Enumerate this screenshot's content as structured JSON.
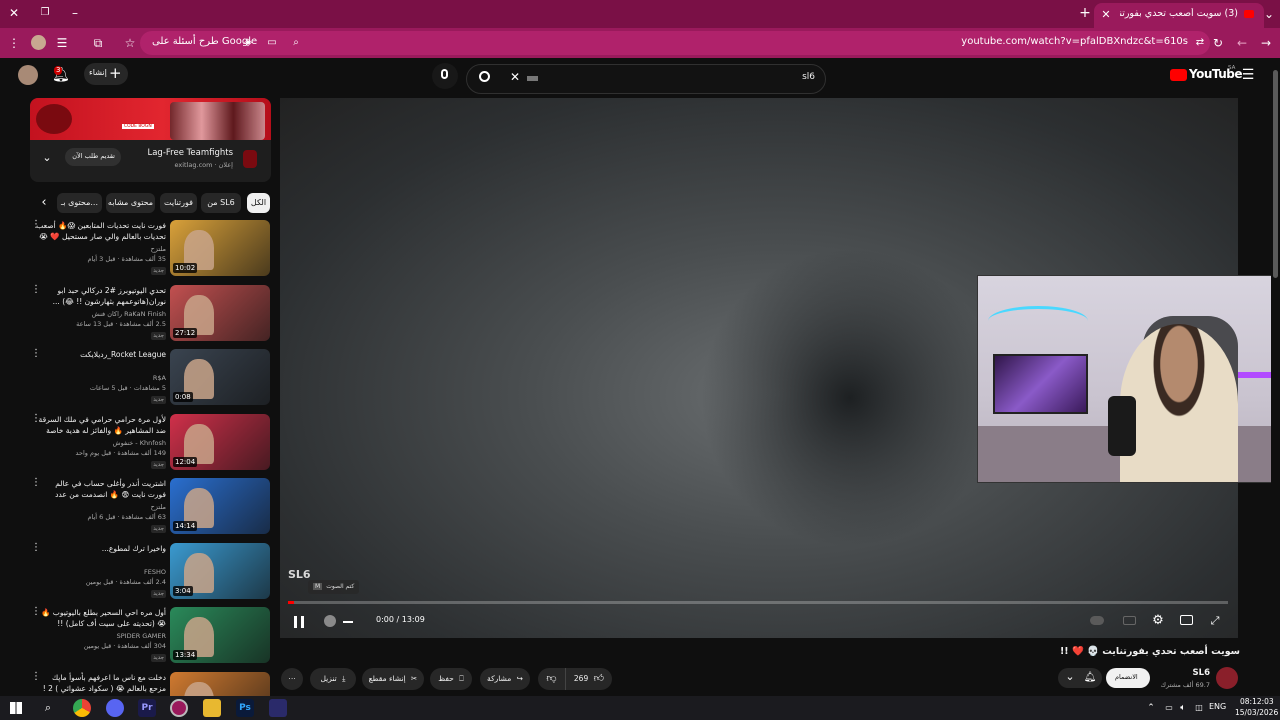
{
  "browser": {
    "tab_title": "(3) سويت أصعب تحدي بفورتنايت",
    "tab_badge": "3",
    "url": "youtube.com/watch?v=pfalDBXndzc&t=610s",
    "google_ask": "طرح أسئلة على Google"
  },
  "header": {
    "logo": "YouTube",
    "logo_region": "SA",
    "search_value": "sl6",
    "create_label": "إنشاء",
    "notif_count": "3"
  },
  "ad": {
    "title": "Lag-Free Teamfights",
    "subtitle": "إعلان · exitlag.com",
    "cta": "تقديم طلب الآن",
    "banner_text": "CODE 8OGN"
  },
  "chips": [
    {
      "label": "الكل",
      "active": true
    },
    {
      "label": "من SL6"
    },
    {
      "label": "فورتنايت"
    },
    {
      "label": "محتوى مشابه"
    },
    {
      "label": "محتوى بـ..."
    }
  ],
  "videos": [
    {
      "title": "فورت نايت تحديات المتابعين 😱🔥 أصعب تحديات بالعالم والي صار مستحيل ❤️ 😭",
      "channel": "ملتزح",
      "meta": "35 ألف مشاهدة · قبل 3 أيام",
      "badge": "جديد",
      "duration": "10:02",
      "thumb_color": "#d9a13a"
    },
    {
      "title": "تحدي اليوتيوبرز #2 دركالي حبد ابو نوران(هاتوعمهم بثهارشون !! 😂) ...",
      "channel": "RaKaN Finish راكان فنش",
      "meta": "2.5 ألف مشاهدة · قبل 13 ساعة",
      "badge": "جديد",
      "duration": "27:12",
      "thumb_color": "#c25050"
    },
    {
      "title": "Rocket League_رديلايكت",
      "channel": "R$A",
      "meta": "5 مشاهدات · قبل 5 ساعات",
      "badge": "جديد",
      "duration": "0:08",
      "thumb_color": "#3a4450"
    },
    {
      "title": "لأول مرة حرامي حرامي في ملك السرقة ضد المشاهير 🔥 والفائز له هدية خاصة",
      "channel": "Khnfosh - خنفوش",
      "meta": "149 ألف مشاهدة · قبل يوم واحد",
      "badge": "جديد",
      "duration": "12:04",
      "thumb_color": "#d0304a"
    },
    {
      "title": "اشتريت أندر وأغلى حساب في عالم فورت نايت 😨 🔥 انصدمت من عدد السكنات 😱",
      "channel": "ملتزح",
      "meta": "63 ألف مشاهدة · قبل 6 أيام",
      "badge": "جديد",
      "duration": "14:14",
      "thumb_color": "#2a6fd0"
    },
    {
      "title": "واخيرا ترك لمطوع...",
      "channel": "FESHO",
      "meta": "2.4 ألف مشاهدة · قبل يومين",
      "badge": "جديد",
      "duration": "3:04",
      "thumb_color": "#3a9ad0"
    },
    {
      "title": "أول مره احي السحير بطلع باليوتيوب 🔥 😭 (تحديته على سيت أف كامل) !!",
      "channel": "SPIDER GAMER",
      "meta": "304 ألف مشاهدة · قبل يومين",
      "badge": "جديد",
      "duration": "13:34",
      "thumb_color": "#2a8a5a"
    },
    {
      "title": "دخلت مع ناس ما اعرفهم بأسوأ ماپك مزحع بالعالم 😭 ( سكواد عشوائي ) 2 ! ...",
      "channel": "",
      "meta": "",
      "badge": "",
      "duration": "",
      "thumb_color": "#d07a30"
    }
  ],
  "player": {
    "time": "0:00 / 13:09",
    "mute_tooltip": "كتم الصوت",
    "mute_key": "M",
    "watermark": "SL6"
  },
  "watch": {
    "title": "سويت أصعب تحدي بفورتنايت 💀 ❤️ !!",
    "channel_name": "SL6",
    "subscribers": "69.7 ألف مشترك",
    "join_label": "الانضمام",
    "likes": "269",
    "share_label": "مشاركة",
    "save_label": "حفظ",
    "clip_label": "إنشاء مقطع",
    "download_label": "تنزيل"
  },
  "taskbar": {
    "lang": "ENG",
    "time": "08:12:03",
    "date": "15/03/2026"
  },
  "colors": {
    "browser_frame": "#7a1046",
    "accent_red": "#ff0000",
    "page_bg": "#0f0f0f"
  }
}
